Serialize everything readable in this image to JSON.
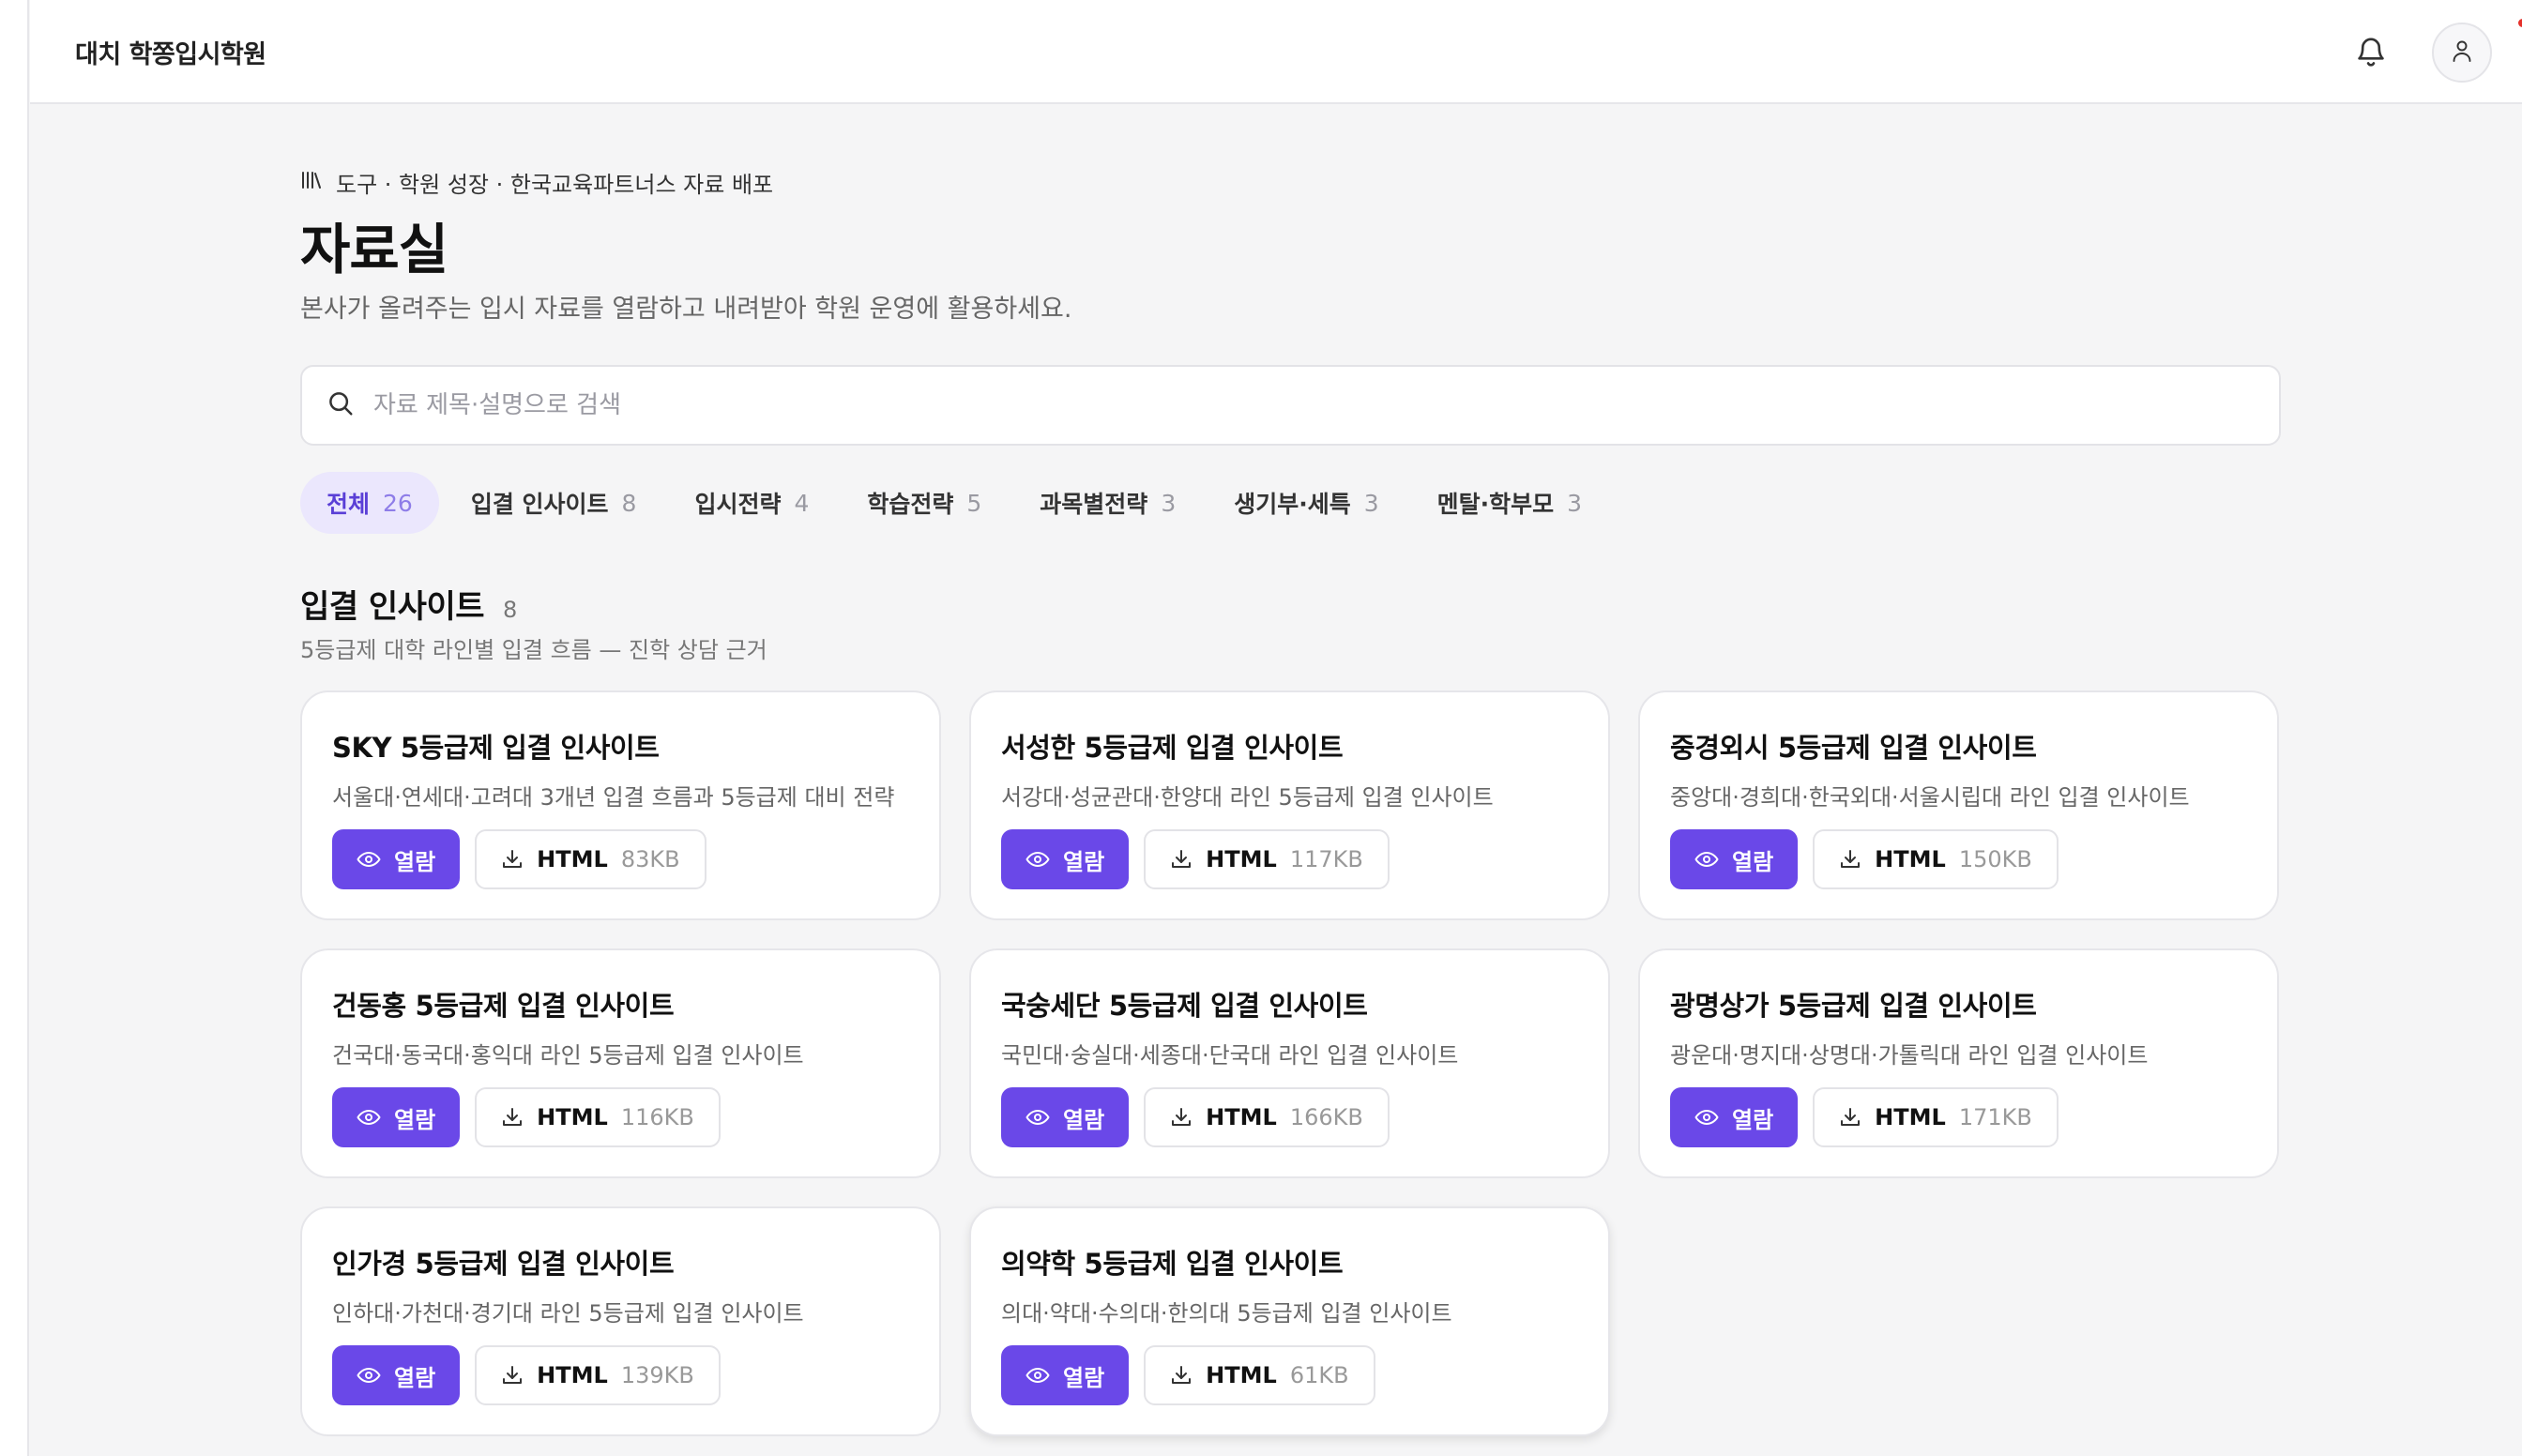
{
  "header": {
    "brand": "대치 학쫑입시학원",
    "icons": [
      "bell-icon",
      "user-icon"
    ],
    "notification_dot_color": "#e5312b"
  },
  "page": {
    "breadcrumb_icon": "library-icon",
    "breadcrumb": "도구 · 학원 성장 · 한국교육파트너스 자료 배포",
    "title": "자료실",
    "subtitle": "본사가 올려주는 입시 자료를 열람하고 내려받아 학원 운영에 활용하세요."
  },
  "search": {
    "placeholder": "자료 제목·설명으로 검색",
    "value": ""
  },
  "filters": [
    {
      "label": "전체",
      "count": "26",
      "active": true
    },
    {
      "label": "입결 인사이트",
      "count": "8",
      "active": false
    },
    {
      "label": "입시전략",
      "count": "4",
      "active": false
    },
    {
      "label": "학습전략",
      "count": "5",
      "active": false
    },
    {
      "label": "과목별전략",
      "count": "3",
      "active": false
    },
    {
      "label": "생기부·세특",
      "count": "3",
      "active": false
    },
    {
      "label": "멘탈·학부모",
      "count": "3",
      "active": false
    }
  ],
  "section": {
    "title": "입결 인사이트",
    "count": "8",
    "subtitle": "5등급제 대학 라인별 입결 흐름 — 진학 상담 근거"
  },
  "buttons": {
    "view_label": "열람",
    "format_label": "HTML"
  },
  "cards": [
    {
      "title": "SKY 5등급제 입결 인사이트",
      "desc": "서울대·연세대·고려대 3개년 입결 흐름과 5등급제 대비 전략",
      "size": "83KB"
    },
    {
      "title": "서성한 5등급제 입결 인사이트",
      "desc": "서강대·성균관대·한양대 라인 5등급제 입결 인사이트",
      "size": "117KB"
    },
    {
      "title": "중경외시 5등급제 입결 인사이트",
      "desc": "중앙대·경희대·한국외대·서울시립대 라인 입결 인사이트",
      "size": "150KB"
    },
    {
      "title": "건동홍 5등급제 입결 인사이트",
      "desc": "건국대·동국대·홍익대 라인 5등급제 입결 인사이트",
      "size": "116KB"
    },
    {
      "title": "국숭세단 5등급제 입결 인사이트",
      "desc": "국민대·숭실대·세종대·단국대 라인 입결 인사이트",
      "size": "166KB"
    },
    {
      "title": "광명상가 5등급제 입결 인사이트",
      "desc": "광운대·명지대·상명대·가톨릭대 라인 입결 인사이트",
      "size": "171KB"
    },
    {
      "title": "인가경 5등급제 입결 인사이트",
      "desc": "인하대·가천대·경기대 라인 5등급제 입결 인사이트",
      "size": "139KB"
    },
    {
      "title": "의약학 5등급제 입결 인사이트",
      "desc": "의대·약대·수의대·한의대 5등급제 입결 인사이트",
      "size": "61KB"
    }
  ],
  "colors": {
    "accent": "#6a48e8",
    "chip_active_bg": "#ebe7fd",
    "chip_active_text": "#5a3fd6",
    "page_bg": "#f5f5f6"
  }
}
